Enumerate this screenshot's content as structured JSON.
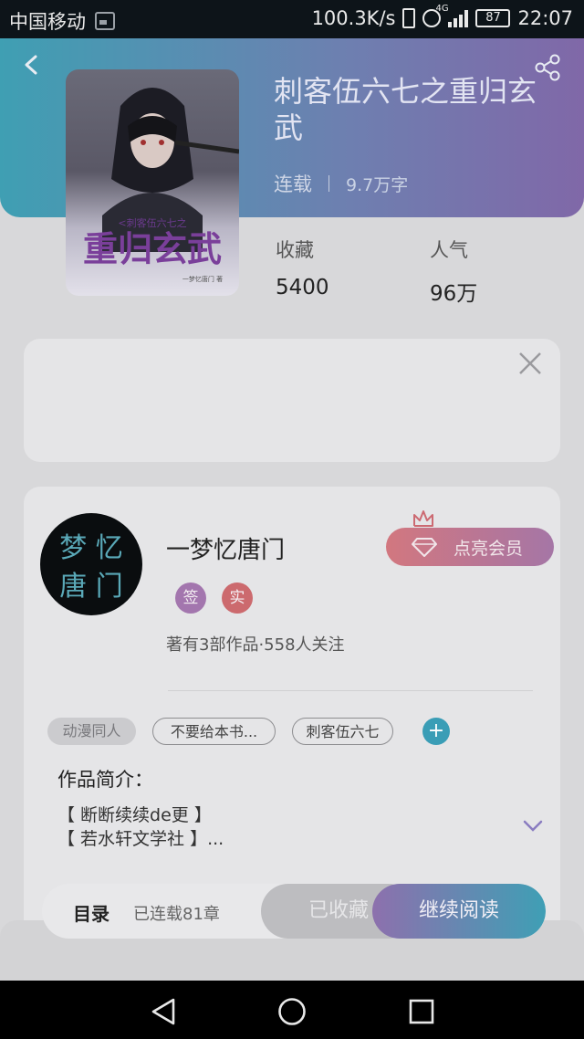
{
  "status_bar": {
    "carrier": "中国移动",
    "speed": "100.3K/s",
    "network": "4G",
    "battery": "87",
    "time": "22:07"
  },
  "book": {
    "title": "刺客伍六七之重归玄武",
    "status": "连载",
    "word_count": "9.7万字"
  },
  "cover": {
    "title_top": "<刺客伍六七之",
    "title_main": "重归玄武",
    "author_small": "一梦忆唐门 著"
  },
  "stats": {
    "collect_label": "收藏",
    "collect_value": "5400",
    "popularity_label": "人气",
    "popularity_value": "96万"
  },
  "author": {
    "name": "一梦忆唐门",
    "badge_signed": "签",
    "badge_real": "实",
    "meta": "著有3部作品·558人关注",
    "vip_label": "点亮会员",
    "avatar_line1": "梦 忆",
    "avatar_line2": "唐 门"
  },
  "tags": [
    "动漫同人",
    "不要给本书...",
    "刺客伍六七"
  ],
  "add_tag": "+",
  "intro": {
    "title": "作品简介：",
    "line1": "【 断断续续de更 】",
    "line2": "【 若水轩文学社 】..."
  },
  "action_bar": {
    "toc": "目录",
    "serialized": "已连载81章",
    "favorited": "已收藏",
    "continue_reading": "继续阅读"
  },
  "colors": {
    "header_start": "#3f9fb3",
    "header_end": "#8068a8",
    "vip_start": "#d2777f",
    "read_end": "#3f9fb5"
  }
}
